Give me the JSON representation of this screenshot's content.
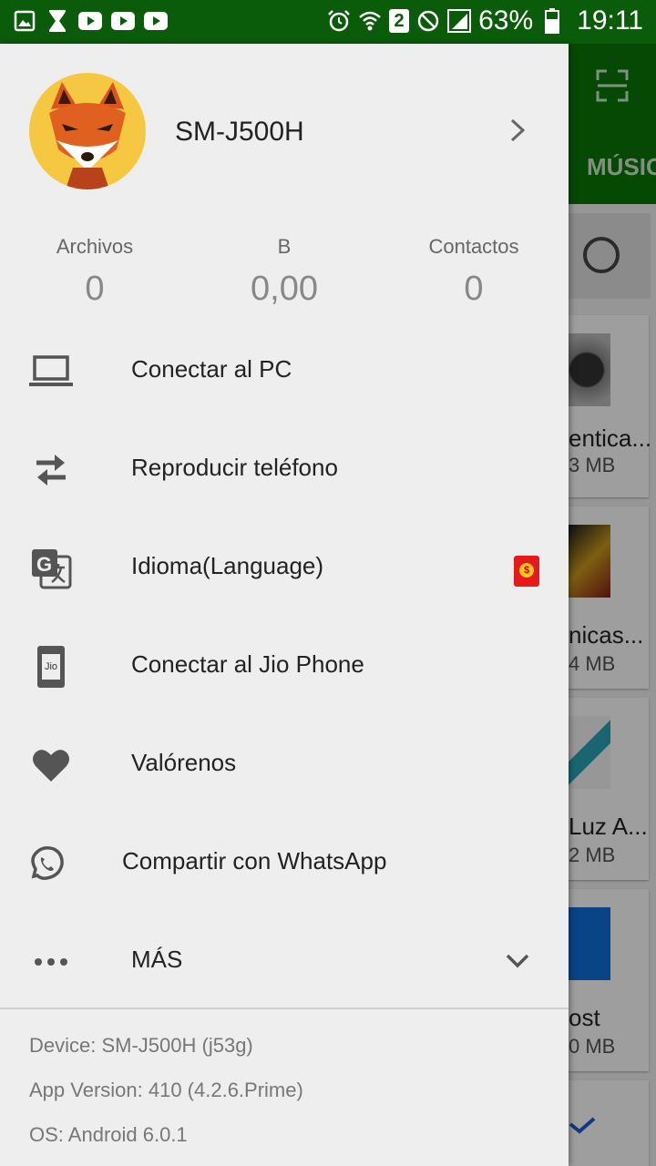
{
  "status_bar": {
    "battery": "63%",
    "time": "19:11",
    "sim_number": "2",
    "left_icons": [
      "gallery-icon",
      "hourglass-icon",
      "youtube-icon",
      "youtube-icon",
      "youtube-icon"
    ],
    "right_icons": [
      "alarm-icon",
      "wifi-icon",
      "sim-icon",
      "do-not-disturb-icon",
      "signal-icon",
      "battery-icon"
    ],
    "background_color": "#0a5c0a"
  },
  "background_app": {
    "tab_label": "MÚSIC",
    "cards": [
      {
        "title": "entica...",
        "size": "3 MB"
      },
      {
        "title": "nicas...",
        "size": "4 MB"
      },
      {
        "title": "Luz A...",
        "size": "2 MB"
      },
      {
        "title": "ost",
        "size": "0 MB"
      }
    ],
    "accent_color": "#097609"
  },
  "drawer": {
    "device_name": "SM-J500H",
    "stats": [
      {
        "label": "Archivos",
        "value": "0"
      },
      {
        "label": "B",
        "value": "0,00"
      },
      {
        "label": "Contactos",
        "value": "0"
      }
    ],
    "menu": [
      {
        "label": "Conectar al PC",
        "icon": "laptop-icon"
      },
      {
        "label": "Reproducir teléfono",
        "icon": "swap-arrows-icon"
      },
      {
        "label": "Idioma(Language)",
        "icon": "translate-icon",
        "badge": "red-envelope-icon",
        "badge_symbol": "$"
      },
      {
        "label": "Conectar al Jio Phone",
        "icon": "jio-phone-icon",
        "icon_text": "Jio"
      },
      {
        "label": "Valórenos",
        "icon": "heart-icon"
      },
      {
        "label": "Compartir con WhatsApp",
        "icon": "whatsapp-icon"
      },
      {
        "label": "MÁS",
        "icon": "more-dots-icon"
      }
    ],
    "footer": {
      "device": "Device: SM-J500H (j53g)",
      "app_version": "App Version: 410 (4.2.6.Prime)",
      "os": "OS: Android 6.0.1"
    }
  }
}
